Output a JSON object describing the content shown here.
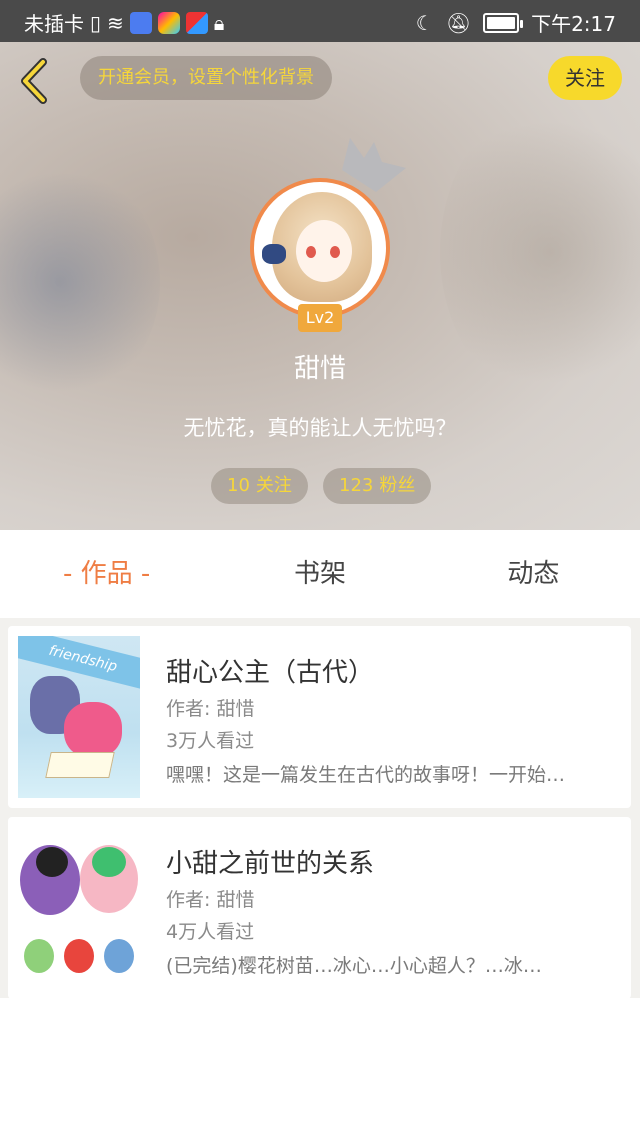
{
  "status_bar": {
    "carrier": "未插卡",
    "time": "下午2:17",
    "battery_level": 0.85
  },
  "header": {
    "vip_prompt": "开通会员，设置个性化背景",
    "follow_label": "关注",
    "level_badge": "Lv2",
    "username": "甜惜",
    "bio": "无忧花，真的能让人无忧吗？",
    "following": {
      "count": "10",
      "label": "关注"
    },
    "fans": {
      "count": "123",
      "label": "粉丝"
    }
  },
  "tabs": [
    {
      "label": "- 作品 -",
      "active": true
    },
    {
      "label": "书架",
      "active": false
    },
    {
      "label": "动态",
      "active": false
    }
  ],
  "works": [
    {
      "title": "甜心公主（古代）",
      "author": "作者: 甜惜",
      "views": "3万人看过",
      "description": "嘿嘿！这是一篇发生在古代的故事呀！一开始…",
      "cover_text": "friendship"
    },
    {
      "title": "小甜之前世的关系",
      "author": "作者: 甜惜",
      "views": "4万人看过",
      "description": "(已完结)樱花树苗…冰心…小心超人？…冰…"
    }
  ],
  "colors": {
    "accent_orange": "#ef7d44",
    "follow_yellow": "#f7d92b",
    "pill_text_yellow": "#f6d63a"
  }
}
